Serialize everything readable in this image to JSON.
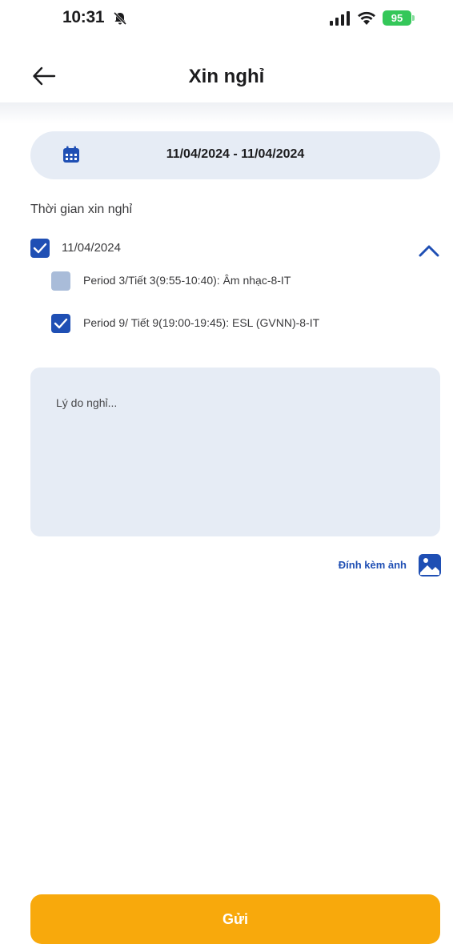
{
  "status_bar": {
    "time": "10:31",
    "battery": "95"
  },
  "header": {
    "title": "Xin nghỉ",
    "back_icon": "arrow-left-icon"
  },
  "date_range": {
    "icon": "calendar-icon",
    "value": "11/04/2024 - 11/04/2024"
  },
  "leave_time": {
    "label": "Thời gian xin nghỉ",
    "date": "11/04/2024",
    "date_checked": true,
    "expanded": true,
    "periods": [
      {
        "label": "Period 3/Tiết 3(9:55-10:40): Âm nhạc-8-IT",
        "checked": false
      },
      {
        "label": "Period 9/ Tiết 9(19:00-19:45): ESL (GVNN)-8-IT",
        "checked": true
      }
    ]
  },
  "reason": {
    "placeholder": "Lý do nghỉ...",
    "value": ""
  },
  "attach": {
    "label": "Đính kèm ảnh",
    "icon": "image-icon"
  },
  "submit": {
    "label": "Gửi"
  },
  "colors": {
    "primary": "#1f4fb4",
    "field_bg": "#e6ecf5",
    "submit": "#f8a90c",
    "battery": "#34c759"
  }
}
